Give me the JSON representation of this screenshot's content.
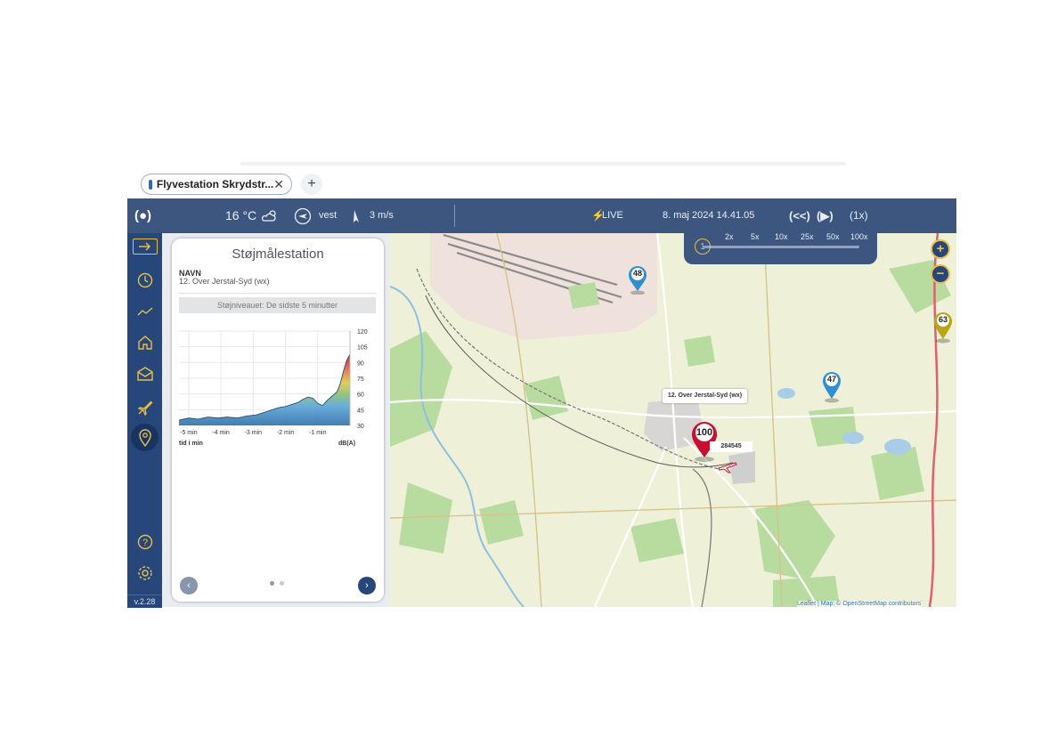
{
  "browser": {
    "tab_title": "Flyvestation Skrydstr...",
    "close_glyph": "✕",
    "new_tab_glyph": "+"
  },
  "topbar": {
    "live_toggle": "(●)",
    "temperature": "16 °C",
    "wind_direction": "vest",
    "wind_speed": "3 m/s",
    "live_label": "LIVE",
    "datetime": "8. maj 2024 14.41.05",
    "rewind_glyph": "(<<)",
    "play_glyph": "(▶)",
    "speed_current": "(1x)",
    "accent_color": "#e9bf4a",
    "bar_color": "#3c5680"
  },
  "speed_options": [
    "2x",
    "5x",
    "10x",
    "25x",
    "50x",
    "100x"
  ],
  "speed_slider_value": "1",
  "sidebar": {
    "items": [
      {
        "icon": "enter-icon",
        "selected": false
      },
      {
        "icon": "clock-icon",
        "selected": false
      },
      {
        "icon": "trend-icon",
        "selected": false
      },
      {
        "icon": "home-icon",
        "selected": false
      },
      {
        "icon": "mail-icon",
        "selected": false
      },
      {
        "icon": "airplane-icon",
        "selected": false
      },
      {
        "icon": "location-pin-icon",
        "selected": true
      },
      {
        "icon": "help-icon",
        "selected": false
      },
      {
        "icon": "settings-icon",
        "selected": false
      }
    ],
    "version": "v.2.28"
  },
  "panel": {
    "title": "Støjmålestation",
    "name_label": "NAVN",
    "station_name": "12. Over Jerstal-Syd (wx)",
    "period_label": "Støjniveauet: De sidste 5 minutter",
    "x_axis_title": "tid i min",
    "unit_label": "dB(A)",
    "prev_glyph": "‹",
    "next_glyph": "›",
    "page_dots": 2,
    "active_dot": 0
  },
  "chart_data": {
    "type": "area",
    "x_tick_labels": [
      "-5 min",
      "-4 min",
      "-3 min",
      "-2 min",
      "-1 min"
    ],
    "y_tick_labels": [
      "120",
      "105",
      "90",
      "75",
      "60",
      "45",
      "30"
    ],
    "ylim": [
      30,
      120
    ],
    "xlim": [
      -5.3,
      0
    ],
    "grid": true,
    "series": [
      {
        "x": [
          -5.3,
          -5.0,
          -4.7,
          -4.4,
          -4.1,
          -3.8,
          -3.5,
          -3.2,
          -2.9,
          -2.6,
          -2.4,
          -2.2,
          -2.0,
          -1.8,
          -1.6,
          -1.45,
          -1.3,
          -1.15,
          -1.0,
          -0.85,
          -0.7,
          -0.55,
          -0.4,
          -0.3,
          -0.2,
          -0.1,
          0
        ],
        "y": [
          35,
          37,
          36,
          38,
          37,
          38,
          37,
          39,
          40,
          43,
          45,
          47,
          48,
          50,
          52,
          55,
          57,
          56,
          51,
          49,
          54,
          58,
          62,
          70,
          82,
          92,
          98
        ]
      }
    ]
  },
  "map": {
    "markers": [
      {
        "value": "48",
        "color": "#2f8fd0"
      },
      {
        "value": "63",
        "color": "#b8a615"
      },
      {
        "value": "47",
        "color": "#2f8fd0"
      },
      {
        "value": "100",
        "color": "#c8102e"
      }
    ],
    "popup_label": "12. Over Jerstal-Syd (wx)",
    "flight_label": "284545",
    "zoom_in": "+",
    "zoom_out": "−",
    "attribution": "Leaflet | Map: © OpenStreetMap contributors"
  }
}
